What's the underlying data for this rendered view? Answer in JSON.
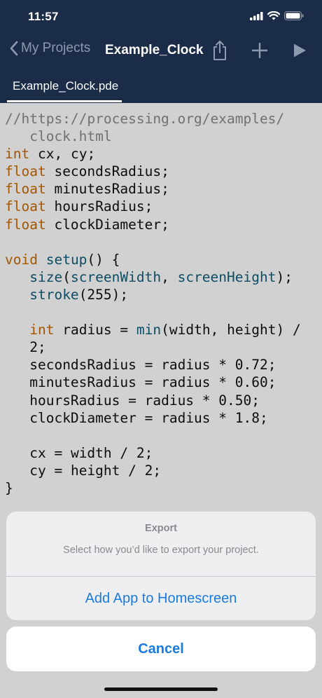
{
  "status_bar": {
    "time": "11:57",
    "icons": [
      "cellular-signal-icon",
      "wifi-icon",
      "battery-icon"
    ]
  },
  "nav": {
    "back_label": "My Projects",
    "title": "Example_Clock",
    "buttons": [
      "share-icon",
      "plus-icon",
      "play-icon"
    ]
  },
  "tabs": [
    {
      "label": "Example_Clock.pde",
      "active": true
    }
  ],
  "code_lines": [
    "//https://processing.org/examples/",
    "   clock.html",
    "int cx, cy;",
    "float secondsRadius;",
    "float minutesRadius;",
    "float hoursRadius;",
    "float clockDiameter;",
    "",
    "void setup() {",
    "   size(screenWidth, screenHeight);",
    "   stroke(255);",
    "",
    "   int radius = min(width, height) /",
    "   2;",
    "   secondsRadius = radius * 0.72;",
    "   minutesRadius = radius * 0.60;",
    "   hoursRadius = radius * 0.50;",
    "   clockDiameter = radius * 1.8;",
    "",
    "   cx = width / 2;",
    "   cy = height / 2;",
    "}"
  ],
  "action_sheet": {
    "title": "Export",
    "message": "Select how you’d like to export your project.",
    "actions": [
      "Add App to Homescreen"
    ],
    "cancel_label": "Cancel"
  },
  "colors": {
    "header_bg": "#1b2c48",
    "accent_blue": "#1a7bdc",
    "code_type": "#c96a00",
    "code_function": "#0f5f7a",
    "code_comment": "#8a8a8a"
  }
}
